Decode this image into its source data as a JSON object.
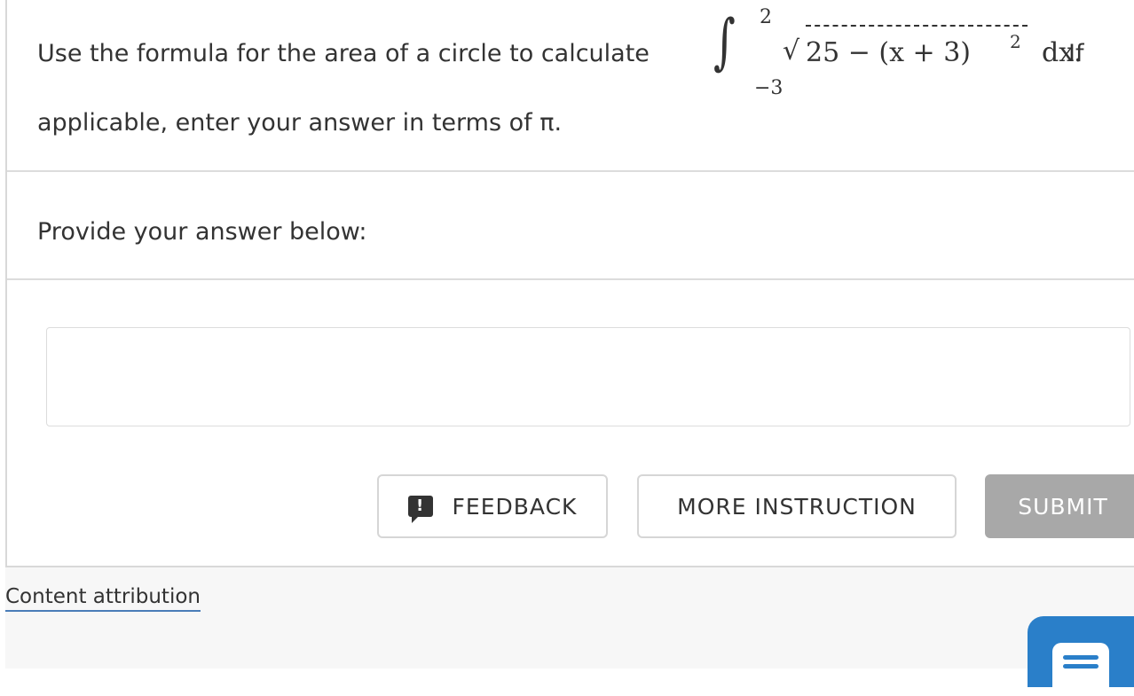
{
  "question": {
    "text_before": "Use the formula for the area of a circle to calculate",
    "integral_upper": "2",
    "integral_lower": "−3",
    "radicand": "25 − (x + 3)",
    "exponent": "2",
    "differential": "dx.",
    "text_after": "If",
    "line2": "applicable, enter your answer in terms of π."
  },
  "prompt": "Provide your answer below:",
  "answer": {
    "value": "",
    "placeholder": ""
  },
  "buttons": {
    "feedback": "FEEDBACK",
    "feedback_icon_glyph": "!",
    "more_instruction": "MORE INSTRUCTION",
    "submit": "SUBMIT"
  },
  "footer": {
    "attribution": "Content attribution"
  },
  "colors": {
    "accent": "#2a7fc9",
    "submit_disabled": "#a8a8a8",
    "border": "#dcdcdc"
  }
}
